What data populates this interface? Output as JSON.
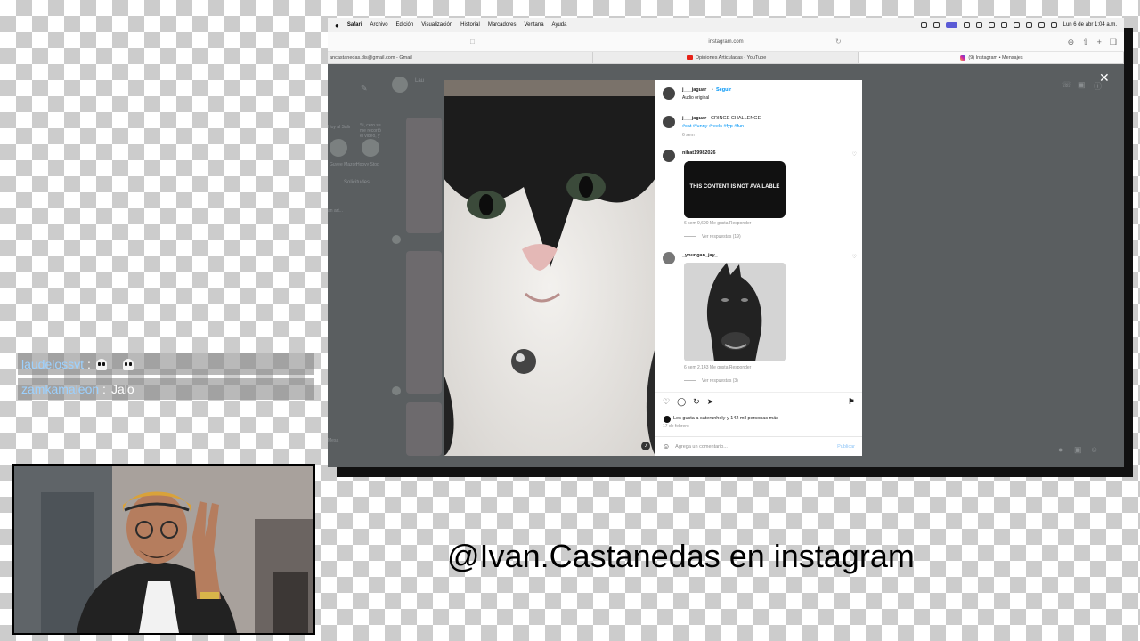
{
  "menubar": {
    "items": [
      "Safari",
      "Archivo",
      "Edición",
      "Visualización",
      "Historial",
      "Marcadores",
      "Ventana",
      "Ayuda"
    ],
    "datetime": "Lun 6 de abr 1:04 a.m."
  },
  "browser": {
    "address": "instagram.com",
    "tabs": [
      {
        "label": "ancastanedas.dis@gmail.com - Gmail"
      },
      {
        "label": "Opiniones Articuladas - YouTube"
      },
      {
        "label": "(9) Instagram • Mensajes"
      }
    ]
  },
  "background": {
    "chat_name": "Lau",
    "requests": "Solicitudes",
    "preview": "Hoy al Salir",
    "snippet": "Si, cero se me recortó el video, y",
    "user1": "Guyee Mazon",
    "user2": "Hoovy Stop",
    "left_item": "an art...",
    "left_meta": "Mesa",
    "age": "5 sem"
  },
  "post": {
    "username": "j___jaguar",
    "follow": "Seguir",
    "audio": "Audio original",
    "caption_user": "j___jaguar",
    "caption_text": "CRINGE CHALLENGE",
    "hashtags": "#cat #funny #reels #fyp #fun",
    "caption_age": "6 sem",
    "comments": [
      {
        "user": "nihat19982026",
        "banner": "THIS CONTENT IS NOT AVAILABLE",
        "meta": "6 sem   9,690 Me gusta   Responder",
        "replies": "Ver respuestas (19)"
      },
      {
        "user": "_youngan_jay_",
        "meta": "6 sem   2,143 Me gusta   Responder",
        "replies": "Ver respuestas (3)"
      }
    ],
    "likes": "Les gusta a saterunholy y 142 mil personas más",
    "date": "17 de febrero",
    "comment_placeholder": "Agrega un comentario...",
    "publish": "Publicar"
  },
  "chat": [
    {
      "user": "laudelossvt",
      "separator": ":",
      "message": ""
    },
    {
      "user": "zamkamaleon",
      "separator": ":",
      "message": "Jalo"
    }
  ],
  "caption": "@Ivan.Castanedas en instagram",
  "icons": {
    "apple": "apple-icon",
    "close": "close-icon",
    "like": "heart-icon",
    "comment": "comment-icon",
    "share": "share-icon",
    "send": "send-icon",
    "save": "bookmark-icon"
  }
}
